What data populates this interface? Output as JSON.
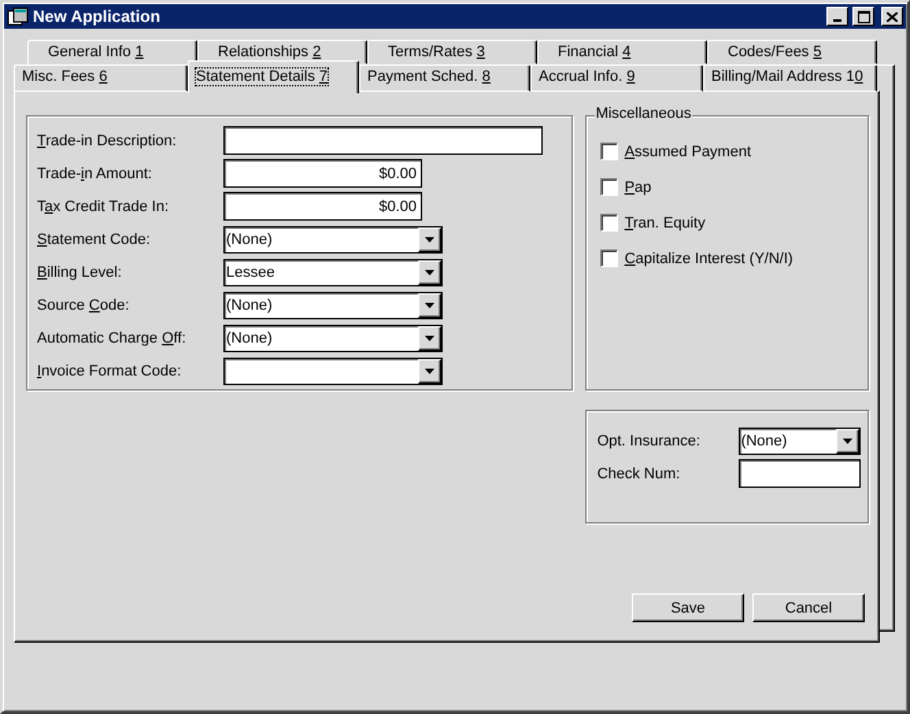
{
  "window": {
    "title": "New Application"
  },
  "tab_rows": [
    {
      "tabs": [
        {
          "label": {
            "pre": "General Info ",
            "key": "1"
          },
          "selected": false
        },
        {
          "label": {
            "pre": "Relationships ",
            "key": "2"
          },
          "selected": false
        },
        {
          "label": {
            "pre": "Terms/Rates ",
            "key": "3"
          },
          "selected": false
        },
        {
          "label": {
            "pre": "Financial ",
            "key": "4"
          },
          "selected": false
        },
        {
          "label": {
            "pre": "Codes/Fees ",
            "key": "5"
          },
          "selected": false
        }
      ]
    },
    {
      "tabs": [
        {
          "label": {
            "pre": "Misc. Fees ",
            "key": "6"
          },
          "selected": false
        },
        {
          "label": {
            "pre": "Statement Details ",
            "key": "7"
          },
          "selected": true
        },
        {
          "label": {
            "pre": "Payment Sched. ",
            "key": "8"
          },
          "selected": false
        },
        {
          "label": {
            "pre": "Accrual Info. ",
            "key": "9"
          },
          "selected": false
        },
        {
          "label": {
            "pre": "Billing/Mail Address 1",
            "key": "0"
          },
          "selected": false
        }
      ]
    }
  ],
  "form": {
    "fields": [
      {
        "kind": "text",
        "label": {
          "key": "T",
          "post": "rade-in Description:"
        }
      },
      {
        "kind": "amount",
        "label": {
          "pre": "Trade-",
          "key": "i",
          "post": "n Amount:"
        },
        "value": "$0.00"
      },
      {
        "kind": "amount",
        "label": {
          "pre": "T",
          "key": "a",
          "post": "x Credit Trade In:"
        },
        "value": "$0.00"
      },
      {
        "kind": "combo",
        "label": {
          "key": "S",
          "post": "tatement Code:"
        },
        "value": "(None)"
      },
      {
        "kind": "combo",
        "label": {
          "key": "B",
          "post": "illing Level:"
        },
        "value": "Lessee"
      },
      {
        "kind": "combo",
        "label": {
          "pre": "Source ",
          "key": "C",
          "post": "ode:"
        },
        "value": "(None)"
      },
      {
        "kind": "combo",
        "label": {
          "pre": "Automatic Charge ",
          "key": "O",
          "post": "ff:"
        },
        "value": "(None)"
      },
      {
        "kind": "combo",
        "label": {
          "key": "I",
          "post": "nvoice Format Code:"
        }
      }
    ]
  },
  "miscellaneous": {
    "title": "Miscellaneous",
    "options": [
      {
        "label": {
          "key": "A",
          "post": "ssumed Payment"
        },
        "checked": false
      },
      {
        "label": {
          "key": "P",
          "post": "ap"
        },
        "checked": false
      },
      {
        "label": {
          "key": "T",
          "post": "ran. Equity"
        },
        "checked": false
      },
      {
        "label": {
          "key": "C",
          "post": "apitalize Interest (Y/N/I)"
        },
        "checked": false
      }
    ]
  },
  "insurance": {
    "fields": [
      {
        "kind": "combo",
        "label": {
          "pre": "Opt. Insurance:"
        },
        "value": "(None)"
      },
      {
        "kind": "text",
        "label": {
          "pre": "Check Num:"
        }
      }
    ]
  },
  "buttons": [
    "Save",
    "Cancel"
  ]
}
